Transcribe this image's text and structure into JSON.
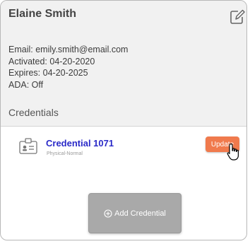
{
  "profile": {
    "name": "Elaine Smith",
    "email": "Email: emily.smith@email.com",
    "activated": "Activated: 04-20-2020",
    "expires": "Expires: 04-20-2025",
    "ada": "ADA: Off"
  },
  "credentials": {
    "heading": "Credentials",
    "items": [
      {
        "title": "Credential 1071",
        "subtitle": "Physical-Normal",
        "update_label": "Update"
      }
    ],
    "add_label": "Add Credential"
  },
  "colors": {
    "update_button": "#f07a4d",
    "credential_link": "#2a2ac8",
    "add_button": "#a9a9a9"
  },
  "icons": {
    "edit": "edit-icon",
    "credential": "id-badge-icon",
    "add": "plus-circle-icon",
    "cursor": "hand-pointer-icon"
  }
}
